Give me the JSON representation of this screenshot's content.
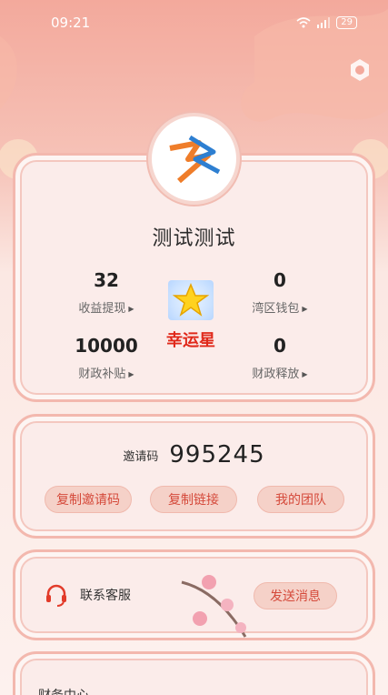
{
  "status_bar": {
    "time": "09:21",
    "battery": "29"
  },
  "user": {
    "name": "测试测试"
  },
  "stats": {
    "earnings": {
      "value": "32",
      "label": "收益提现"
    },
    "wallet": {
      "value": "0",
      "label": "湾区钱包"
    },
    "subsidy": {
      "value": "10000",
      "label": "财政补贴"
    },
    "release": {
      "value": "0",
      "label": "财政释放"
    }
  },
  "level": {
    "name": "幸运星"
  },
  "invite": {
    "label": "邀请码",
    "code": "995245",
    "copy_code": "复制邀请码",
    "copy_link": "复制链接",
    "my_team": "我的团队"
  },
  "service": {
    "label": "联系客服",
    "send": "发送消息"
  },
  "finance": {
    "title": "财务中心"
  },
  "colors": {
    "accent": "#d54a3b",
    "level": "#e0281a",
    "card_border": "#f3b8ae"
  }
}
